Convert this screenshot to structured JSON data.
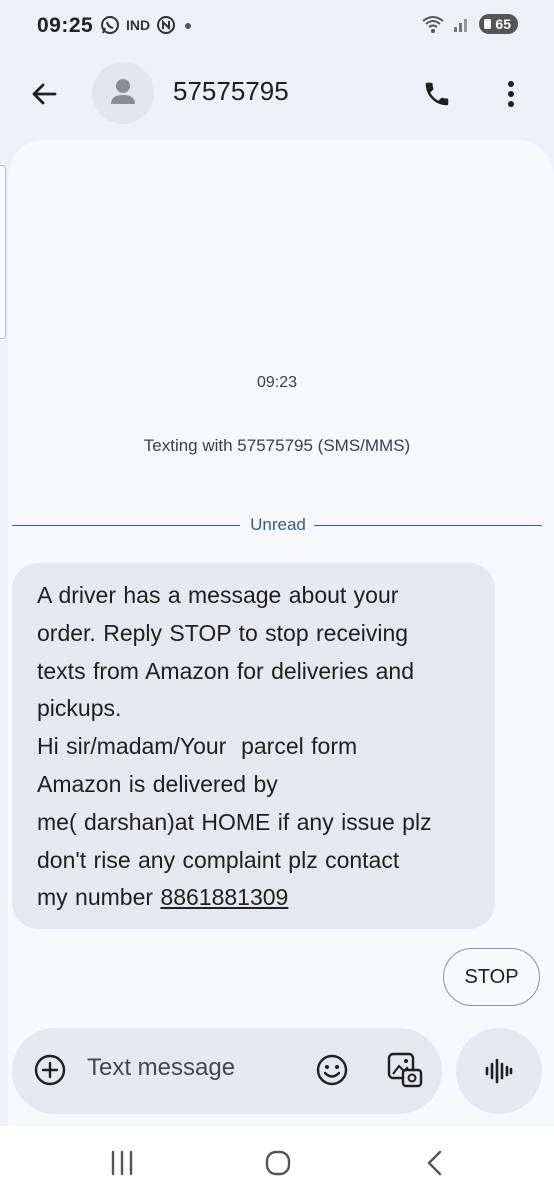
{
  "status_bar": {
    "time": "09:25",
    "carrier_label": "IND",
    "battery_level": "65"
  },
  "header": {
    "contact_name": "57575795"
  },
  "conversation": {
    "timestamp": "09:23",
    "texting_info": "Texting with 57575795 (SMS/MMS)",
    "unread_label": "Unread",
    "message_text": "A driver has a message about your\norder. Reply STOP to stop receiving\ntexts from Amazon for deliveries and\npickups.\nHi sir/madam/Your  parcel form\nAmazon is delivered by\nme( darshan)at HOME if any issue plz\ndon't rise any complaint plz contact\nmy number ",
    "phone_link": "8861881309"
  },
  "smart_reply": {
    "label": "STOP"
  },
  "composer": {
    "placeholder": "Text message"
  },
  "colors": {
    "background": "#eef0f6",
    "bubble": "#e7e8ee",
    "unread_accent": "#3d5a80"
  }
}
